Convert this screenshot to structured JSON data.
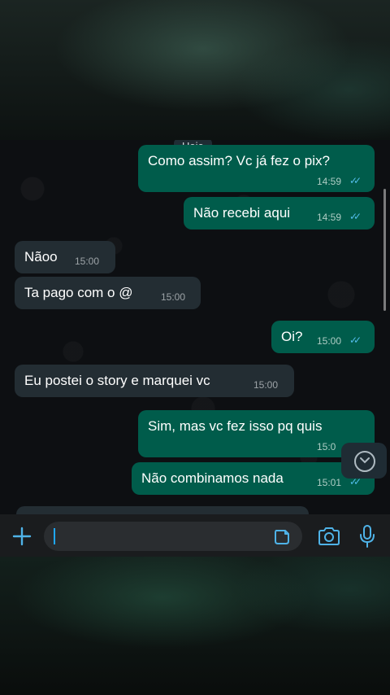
{
  "chat": {
    "date_label": "Hoje",
    "messages": [
      {
        "direction": "out",
        "text": "Como assim? Vc já fez o pix?",
        "time": "14:59",
        "ticks": "✓✓"
      },
      {
        "direction": "out",
        "text": "Não recebi aqui",
        "time": "14:59",
        "ticks": "✓✓"
      },
      {
        "direction": "in",
        "text": "Nãoo",
        "time": "15:00"
      },
      {
        "direction": "in",
        "text": "Ta pago com o @",
        "time": "15:00"
      },
      {
        "direction": "out",
        "text": "Oi?",
        "time": "15:00",
        "ticks": "✓✓"
      },
      {
        "direction": "in",
        "text": "Eu postei o story e marquei vc",
        "time": "15:00"
      },
      {
        "direction": "out",
        "text": "Sim, mas vc fez isso pq quis",
        "time": "15:0",
        "ticks": ""
      },
      {
        "direction": "out",
        "text": "Não combinamos nada",
        "time": "15:01",
        "ticks": "✓✓"
      }
    ]
  },
  "input_bar": {
    "plus_icon": "plus-icon",
    "sticker_icon": "sticker-icon",
    "camera_icon": "camera-icon",
    "mic_icon": "microphone-icon",
    "text_value": ""
  },
  "colors": {
    "outgoing_bubble": "#005c4b",
    "incoming_bubble": "#232d33",
    "read_ticks": "#53bdeb",
    "accent": "#1fa7ff"
  }
}
